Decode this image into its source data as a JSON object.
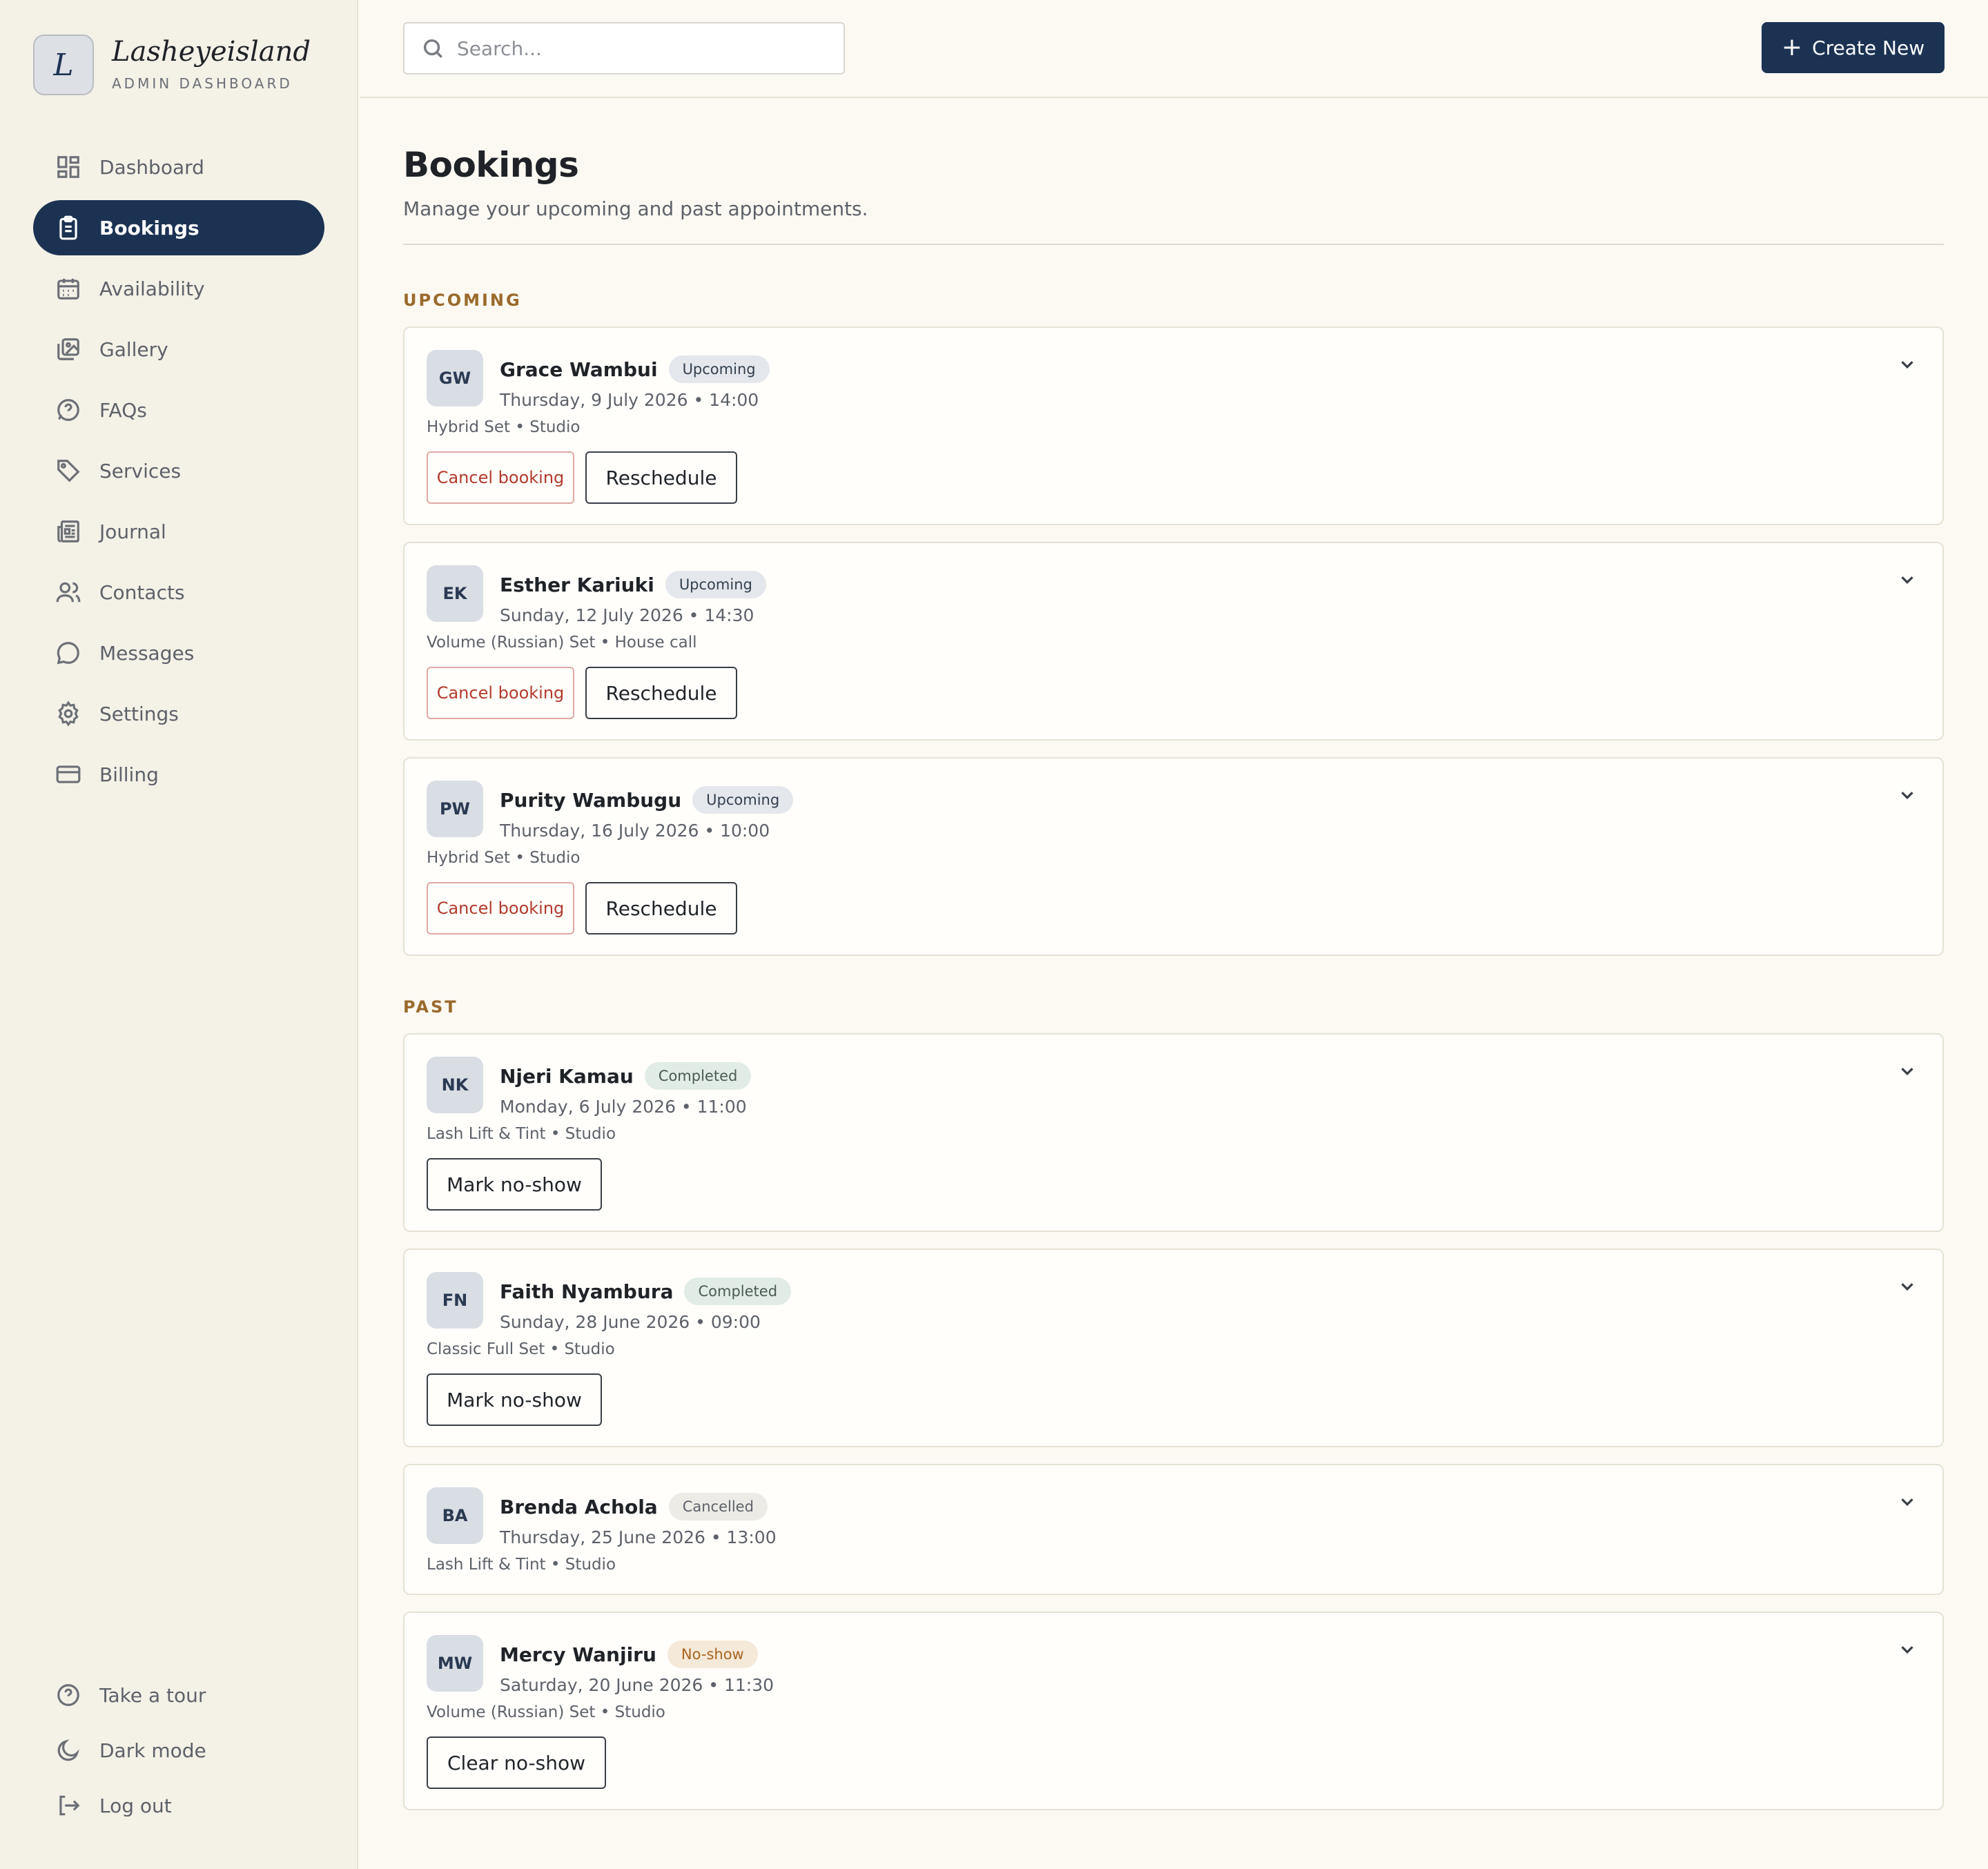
{
  "brand": {
    "initial": "L",
    "name": "Lasheyeisland",
    "subtitle": "ADMIN DASHBOARD"
  },
  "nav": [
    {
      "label": "Dashboard",
      "icon": "dashboard-icon",
      "active": false
    },
    {
      "label": "Bookings",
      "icon": "clipboard-icon",
      "active": true
    },
    {
      "label": "Availability",
      "icon": "calendar-icon",
      "active": false
    },
    {
      "label": "Gallery",
      "icon": "image-icon",
      "active": false
    },
    {
      "label": "FAQs",
      "icon": "help-circle-icon",
      "active": false
    },
    {
      "label": "Services",
      "icon": "tag-icon",
      "active": false
    },
    {
      "label": "Journal",
      "icon": "newspaper-icon",
      "active": false
    },
    {
      "label": "Contacts",
      "icon": "users-icon",
      "active": false
    },
    {
      "label": "Messages",
      "icon": "chat-icon",
      "active": false
    },
    {
      "label": "Settings",
      "icon": "gear-icon",
      "active": false
    },
    {
      "label": "Billing",
      "icon": "credit-card-icon",
      "active": false
    }
  ],
  "nav_bottom": [
    {
      "label": "Take a tour",
      "icon": "help-circle-icon"
    },
    {
      "label": "Dark mode",
      "icon": "moon-icon"
    },
    {
      "label": "Log out",
      "icon": "logout-icon"
    }
  ],
  "header": {
    "search_placeholder": "Search...",
    "create_label": "Create New"
  },
  "page": {
    "title": "Bookings",
    "subtitle": "Manage your upcoming and past appointments."
  },
  "sections": {
    "upcoming": "UPCOMING",
    "past": "PAST"
  },
  "colors": {
    "navy": "#1b3253",
    "accent": "#9a6a2c",
    "cancel_red": "#b33a2c"
  },
  "upcoming": [
    {
      "initials": "GW",
      "name": "Grace Wambui",
      "status": "Upcoming",
      "when": "Thursday, 9 July 2026 • 14:00",
      "service": "Hybrid Set • Studio",
      "cancel_label": "Cancel booking",
      "reschedule_label": "Reschedule"
    },
    {
      "initials": "EK",
      "name": "Esther Kariuki",
      "status": "Upcoming",
      "when": "Sunday, 12 July 2026 • 14:30",
      "service": "Volume (Russian) Set • House call",
      "cancel_label": "Cancel booking",
      "reschedule_label": "Reschedule"
    },
    {
      "initials": "PW",
      "name": "Purity Wambugu",
      "status": "Upcoming",
      "when": "Thursday, 16 July 2026 • 10:00",
      "service": "Hybrid Set • Studio",
      "cancel_label": "Cancel booking",
      "reschedule_label": "Reschedule"
    }
  ],
  "past": [
    {
      "initials": "NK",
      "name": "Njeri Kamau",
      "status": "Completed",
      "when": "Monday, 6 July 2026 • 11:00",
      "service": "Lash Lift & Tint • Studio",
      "action_label": "Mark no-show"
    },
    {
      "initials": "FN",
      "name": "Faith Nyambura",
      "status": "Completed",
      "when": "Sunday, 28 June 2026 • 09:00",
      "service": "Classic Full Set • Studio",
      "action_label": "Mark no-show"
    },
    {
      "initials": "BA",
      "name": "Brenda Achola",
      "status": "Cancelled",
      "when": "Thursday, 25 June 2026 • 13:00",
      "service": "Lash Lift & Tint • Studio"
    },
    {
      "initials": "MW",
      "name": "Mercy Wanjiru",
      "status": "No-show",
      "when": "Saturday, 20 June 2026 • 11:30",
      "service": "Volume (Russian) Set • Studio",
      "action_label": "Clear no-show"
    }
  ]
}
